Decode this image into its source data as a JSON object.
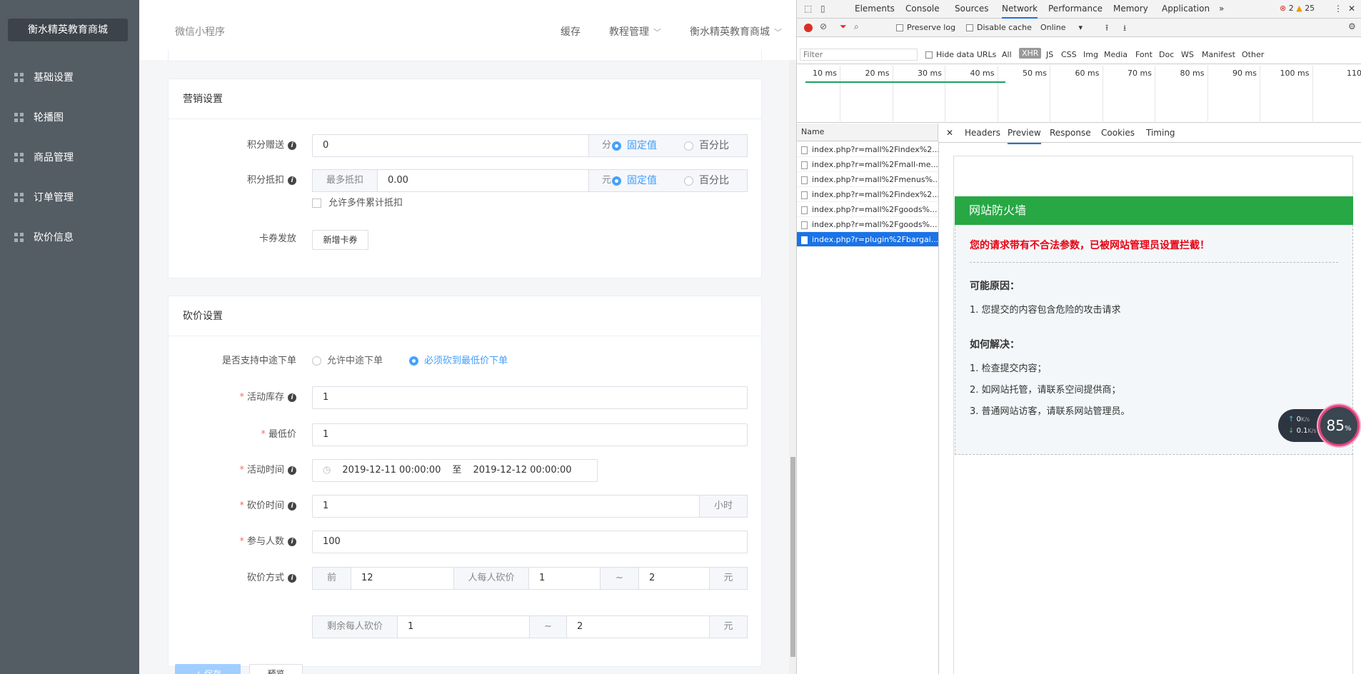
{
  "app": {
    "brand": "衡水精英教育商城",
    "menu": [
      "基础设置",
      "轮播图",
      "商品管理",
      "订单管理",
      "砍价信息"
    ],
    "topbar": {
      "mini_program": "微信小程序",
      "cache": "缓存",
      "tutorial": "教程管理",
      "store": "衡水精英教育商城"
    }
  },
  "marketing": {
    "title": "营销设置",
    "points_give_label": "积分赠送",
    "points_give_value": "0",
    "points_give_unit": "分",
    "points_deduct_label": "积分抵扣",
    "points_deduct_prefix": "最多抵扣",
    "points_deduct_value": "0.00",
    "points_deduct_unit": "元",
    "fixed_label": "固定值",
    "percent_label": "百分比",
    "allow_multi": "允许多件累计抵扣",
    "coupon_label": "卡券发放",
    "coupon_button": "新增卡券"
  },
  "bargain": {
    "title": "砍价设置",
    "midway_label": "是否支持中途下单",
    "midway_opt1": "允许中途下单",
    "midway_opt2": "必须砍到最低价下单",
    "stock_label": "活动库存",
    "stock_value": "1",
    "min_price_label": "最低价",
    "min_price_value": "1",
    "time_label": "活动时间",
    "time_start": "2019-12-11 00:00:00",
    "time_sep": "至",
    "time_end": "2019-12-12 00:00:00",
    "bargain_time_label": "砍价时间",
    "bargain_time_value": "1",
    "bargain_time_unit": "小时",
    "participants_label": "参与人数",
    "participants_value": "100",
    "method_label": "砍价方式",
    "method_front": "前",
    "method_front_value": "12",
    "method_per_person": "人每人砍价",
    "method_min": "1",
    "tilde": "~",
    "method_max": "2",
    "yuan": "元",
    "remaining_label": "剩余每人砍价",
    "remaining_min": "1",
    "remaining_max": "2"
  },
  "footer": {
    "save": "保存",
    "preview": "预览"
  },
  "devtools": {
    "tabs": [
      "Elements",
      "Console",
      "Sources",
      "Network",
      "Performance",
      "Memory",
      "Application"
    ],
    "errors": "2",
    "warnings": "25",
    "preserve_log": "Preserve log",
    "disable_cache": "Disable cache",
    "throttle": "Online",
    "filter_placeholder": "Filter",
    "hide_data_urls": "Hide data URLs",
    "filters": [
      "All",
      "XHR",
      "JS",
      "CSS",
      "Img",
      "Media",
      "Font",
      "Doc",
      "WS",
      "Manifest",
      "Other"
    ],
    "ruler": [
      "10 ms",
      "20 ms",
      "30 ms",
      "40 ms",
      "50 ms",
      "60 ms",
      "70 ms",
      "80 ms",
      "90 ms",
      "100 ms",
      "110"
    ],
    "name_header": "Name",
    "requests": [
      "index.php?r=mall%2Findex%2...",
      "index.php?r=mall%2Fmall-me...",
      "index.php?r=mall%2Fmenus%...",
      "index.php?r=mall%2Findex%2...",
      "index.php?r=mall%2Fgoods%...",
      "index.php?r=mall%2Fgoods%...",
      "index.php?r=plugin%2Fbargai..."
    ],
    "panel_tabs": [
      "Headers",
      "Preview",
      "Response",
      "Cookies",
      "Timing"
    ],
    "preview": {
      "header": "网站防火墙",
      "alert": "您的请求带有不合法参数，已被网站管理员设置拦截！",
      "cause_title": "可能原因：",
      "causes": [
        "1.  您提交的内容包含危险的攻击请求"
      ],
      "solve_title": "如何解决：",
      "solutions": [
        "1.  检查提交内容；",
        "2.  如网站托管，请联系空间提供商；",
        "3.  普通网站访客，请联系网站管理员。"
      ]
    },
    "widget": {
      "up": "0",
      "up_unit": "K/s",
      "down": "0.1",
      "down_unit": "K/s",
      "percent": "85",
      "percent_unit": "%"
    }
  }
}
